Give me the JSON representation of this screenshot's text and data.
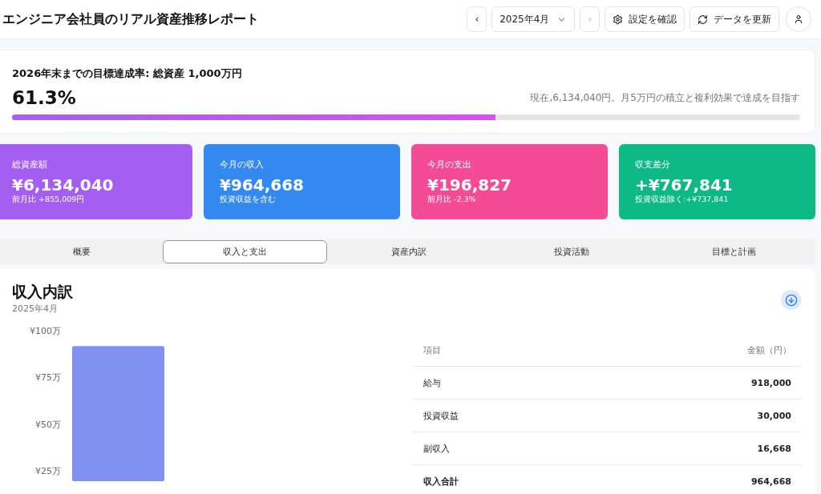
{
  "header": {
    "title": "エンジニア会社員のリアル資産推移レポート",
    "prev_label": "‹",
    "month": "2025年4月",
    "next_disabled": true,
    "next_label": "›",
    "settings_button": "設定を確認",
    "refresh_button": "データを更新"
  },
  "goal": {
    "title": "2026年末までの目標達成率: 総資産 1,000万円",
    "percent": "61.3%",
    "note": "現在,6,134,040円。月5万円の積立と複利効果で達成を目指す",
    "level": 0.613
  },
  "stats": [
    {
      "label": "総資産額",
      "value": "¥6,134,040",
      "sub": "前月比 +855,009円",
      "color": "#a45ff0"
    },
    {
      "label": "今月の収入",
      "value": "¥964,668",
      "sub": "投資収益を含む",
      "color": "#3389f0"
    },
    {
      "label": "今月の支出",
      "value": "¥196,827",
      "sub": "前月比 -2.3%",
      "color": "#f34b96"
    },
    {
      "label": "収支差分",
      "value": "+¥767,841",
      "sub": "投資収益除く:+¥737,841",
      "color": "#0dba85"
    }
  ],
  "tabs": [
    {
      "label": "概要",
      "selected": false
    },
    {
      "label": "収入と支出",
      "selected": true
    },
    {
      "label": "資産内訳",
      "selected": false
    },
    {
      "label": "投資活動",
      "selected": false
    },
    {
      "label": "目標と計画",
      "selected": false
    }
  ],
  "panel": {
    "title": "収入内訳",
    "subtitle": "2025年4月",
    "chart_data": {
      "type": "bar",
      "categories": [
        null
      ],
      "series": [
        {
          "color": "#8091f2",
          "values": [
            91.8
          ]
        }
      ],
      "ylim": [
        19.5,
        100
      ],
      "yticks": [
        {
          "value": 25,
          "label": "¥25万"
        },
        {
          "value": 50,
          "label": "¥50万"
        },
        {
          "value": 75,
          "label": "¥75万"
        },
        {
          "value": 100,
          "label": "¥100万"
        }
      ]
    },
    "table": {
      "columns": [
        "項目",
        "金額（円）"
      ],
      "rows": [
        {
          "item": "給与",
          "amount": "918,000",
          "total": false
        },
        {
          "item": "投資収益",
          "amount": "30,000",
          "total": false
        },
        {
          "item": "副収入",
          "amount": "16,668",
          "total": false
        },
        {
          "item": "収入合計",
          "amount": "964,668",
          "total": true
        }
      ]
    }
  }
}
